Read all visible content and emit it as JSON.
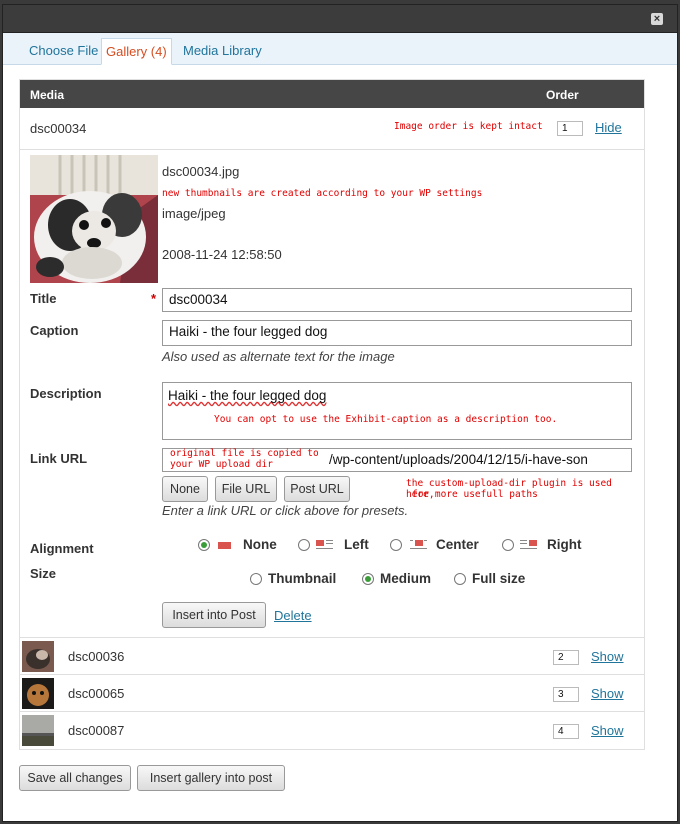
{
  "tabs": [
    {
      "label": "Choose File"
    },
    {
      "label": "Gallery (4)"
    },
    {
      "label": "Media Library"
    }
  ],
  "close_label": "×",
  "table": {
    "col_media": "Media",
    "col_order": "Order"
  },
  "expanded_item": {
    "name": "dsc00034",
    "order": "1",
    "toggle": "Hide",
    "annotation_order": "Image order is kept intact",
    "filename": "dsc00034.jpg",
    "annotation_thumbs": "new thumbnails are created according to your WP settings",
    "mime": "image/jpeg",
    "date": "2008-11-24 12:58:50",
    "title_label": "Title",
    "required_mark": "*",
    "title_value": "dsc00034",
    "caption_label": "Caption",
    "caption_value": "Haiki - the four legged dog",
    "caption_help": "Also used as alternate text for the image",
    "description_label": "Description",
    "description_value": "Haiki - the four legged dog",
    "annotation_description": "You can opt to use the Exhibit-caption as a description too.",
    "link_label": "Link URL",
    "annotation_link_1": "original file is copied to",
    "annotation_link_2": "your WP upload dir",
    "link_value": "/wp-content/uploads/2004/12/15/i-have-son",
    "btn_none": "None",
    "btn_file_url": "File URL",
    "btn_post_url": "Post URL",
    "annotation_plugin_1": "the custom-upload-dir plugin is used here,",
    "annotation_plugin_2": "for more usefull paths",
    "link_help": "Enter a link URL or click above for presets.",
    "alignment_label": "Alignment",
    "align_none": "None",
    "align_left": "Left",
    "align_center": "Center",
    "align_right": "Right",
    "size_label": "Size",
    "size_thumbnail": "Thumbnail",
    "size_medium": "Medium",
    "size_full": "Full size",
    "insert_btn": "Insert into Post",
    "delete_link": "Delete"
  },
  "collapsed_items": [
    {
      "name": "dsc00036",
      "order": "2",
      "toggle": "Show"
    },
    {
      "name": "dsc00065",
      "order": "3",
      "toggle": "Show"
    },
    {
      "name": "dsc00087",
      "order": "4",
      "toggle": "Show"
    }
  ],
  "footer": {
    "save_all": "Save all changes",
    "insert_gallery": "Insert gallery into post"
  },
  "colors": {
    "accent_link": "#21759b",
    "active_tab": "#d54e21",
    "annotation": "#e00000",
    "header_bar": "#464646"
  }
}
